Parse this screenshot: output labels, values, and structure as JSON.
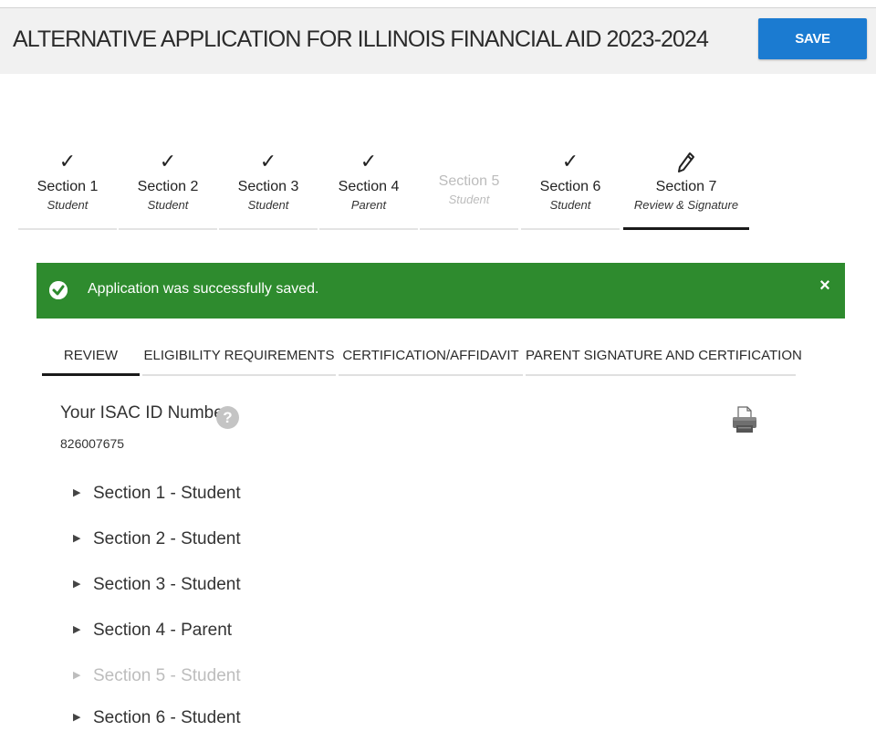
{
  "header": {
    "title": "ALTERNATIVE APPLICATION FOR ILLINOIS FINANCIAL AID 2023-2024",
    "save_label": "SAVE"
  },
  "steps": [
    {
      "title": "Section 1",
      "sub": "Student",
      "status": "complete",
      "icon": "checkmark-icon"
    },
    {
      "title": "Section 2",
      "sub": "Student",
      "status": "complete",
      "icon": "checkmark-icon"
    },
    {
      "title": "Section 3",
      "sub": "Student",
      "status": "complete",
      "icon": "checkmark-icon"
    },
    {
      "title": "Section 4",
      "sub": "Parent",
      "status": "complete",
      "icon": "checkmark-icon"
    },
    {
      "title": "Section 5",
      "sub": "Student",
      "status": "disabled",
      "icon": ""
    },
    {
      "title": "Section 6",
      "sub": "Student",
      "status": "complete",
      "icon": "checkmark-icon"
    },
    {
      "title": "Section 7",
      "sub": "Review & Signature",
      "status": "active",
      "icon": "pencil-icon"
    }
  ],
  "alert": {
    "message": "Application was successfully saved.",
    "close_label": "×",
    "color": "#2e8b2e"
  },
  "tabs": [
    "REVIEW",
    "ELIGIBILITY REQUIREMENTS",
    "CERTIFICATION/AFFIDAVIT",
    "PARENT SIGNATURE AND CERTIFICATION"
  ],
  "active_tab": "REVIEW",
  "isac": {
    "label": "Your ISAC ID Number",
    "help": "?",
    "value": "826007675"
  },
  "review_sections": [
    {
      "label": "Section 1 - Student",
      "enabled": true
    },
    {
      "label": "Section 2 - Student",
      "enabled": true
    },
    {
      "label": "Section 3 - Student",
      "enabled": true
    },
    {
      "label": "Section 4 - Parent",
      "enabled": true
    },
    {
      "label": "Section 5 - Student",
      "enabled": false
    },
    {
      "label": "Section 6 - Student",
      "enabled": true
    }
  ],
  "colors": {
    "accent": "#1b7bd1",
    "success": "#2e8b2e",
    "disabled": "#bdbdbd"
  }
}
